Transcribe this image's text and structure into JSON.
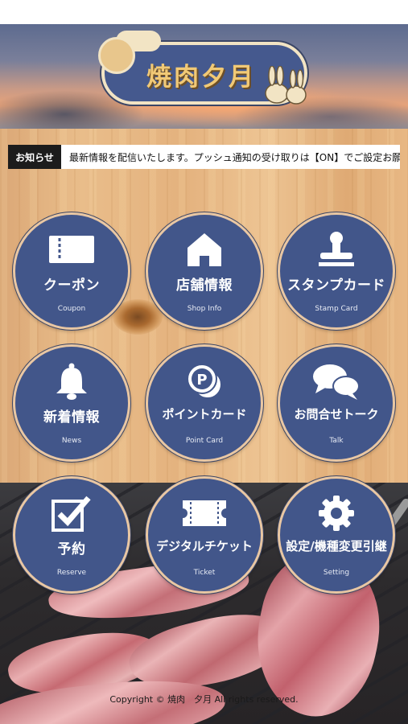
{
  "header": {
    "logo_text": "焼肉夕月"
  },
  "news": {
    "label": "お知らせ",
    "text": "最新情報を配信いたします。プッシュ通知の受け取りは【ON】でご設定お願い"
  },
  "menu": [
    {
      "label": "クーポン",
      "sub": "Coupon",
      "icon": "ticket-icon"
    },
    {
      "label": "店舗情報",
      "sub": "Shop Info",
      "icon": "house-icon"
    },
    {
      "label": "スタンプカード",
      "sub": "Stamp Card",
      "icon": "stamp-icon"
    },
    {
      "label": "新着情報",
      "sub": "News",
      "icon": "bell-icon"
    },
    {
      "label": "ポイントカード",
      "sub": "Point Card",
      "icon": "point-coin-icon"
    },
    {
      "label": "お問合せトーク",
      "sub": "Talk",
      "icon": "chat-bubbles-icon"
    },
    {
      "label": "予約",
      "sub": "Reserve",
      "icon": "checkbox-icon"
    },
    {
      "label": "デジタルチケット",
      "sub": "Ticket",
      "icon": "digital-ticket-icon"
    },
    {
      "label": "設定/機種変更引継",
      "sub": "Setting",
      "icon": "gear-icon"
    }
  ],
  "footer": {
    "copyright": "Copyright © 焼肉　夕月 All rights reserved."
  },
  "colors": {
    "button_fill": "#42568a",
    "button_border": "#e9c7a3",
    "news_label_bg": "#1c1c1c"
  }
}
